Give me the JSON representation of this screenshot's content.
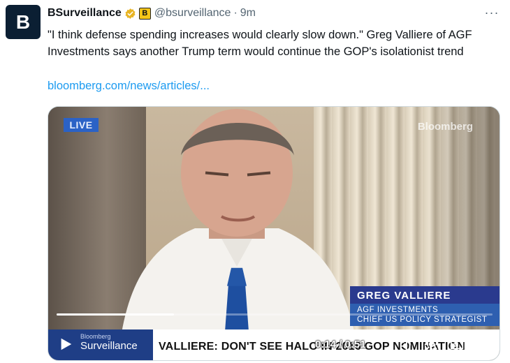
{
  "tweet": {
    "avatar_letter": "B",
    "display_name": "BSurveillance",
    "affiliate_badge": "B",
    "handle": "@bsurveillance",
    "separator": "·",
    "time": "9m",
    "text": "\"I think defense spending increases would clearly slow down.\" Greg Valliere of AGF Investments says another Trump term would continue the GOP's isolationist trend",
    "link": "bloomberg.com/news/articles/...",
    "more_label": "···"
  },
  "video": {
    "live_badge": "LIVE",
    "watermark": "Bloomberg",
    "lower_third": {
      "name": "GREG VALLIERE",
      "company": "AGF INVESTMENTS",
      "title": "CHIEF US POLICY STRATEGIST"
    },
    "show_brand": {
      "line1": "Bloomberg",
      "line2": "Surveillance"
    },
    "headline": "VALLIERE: DON'T SEE HALO IN 2016 GOP NOMINATION",
    "time_display": "0:14 / 0:51",
    "progress_fraction": 0.27
  },
  "icons": {
    "verified": "verified-badge-icon",
    "more": "more-options-icon",
    "play": "play-icon",
    "volume": "volume-icon",
    "settings": "gear-icon",
    "pip": "picture-in-picture-icon",
    "fullscreen": "fullscreen-icon"
  },
  "colors": {
    "link": "#1d9bf0",
    "verified_gold": "#e8b424",
    "live_badge": "#2b62c6",
    "lower_third_dark": "#2a3a8e",
    "lower_third_light": "#2e5fb0"
  }
}
